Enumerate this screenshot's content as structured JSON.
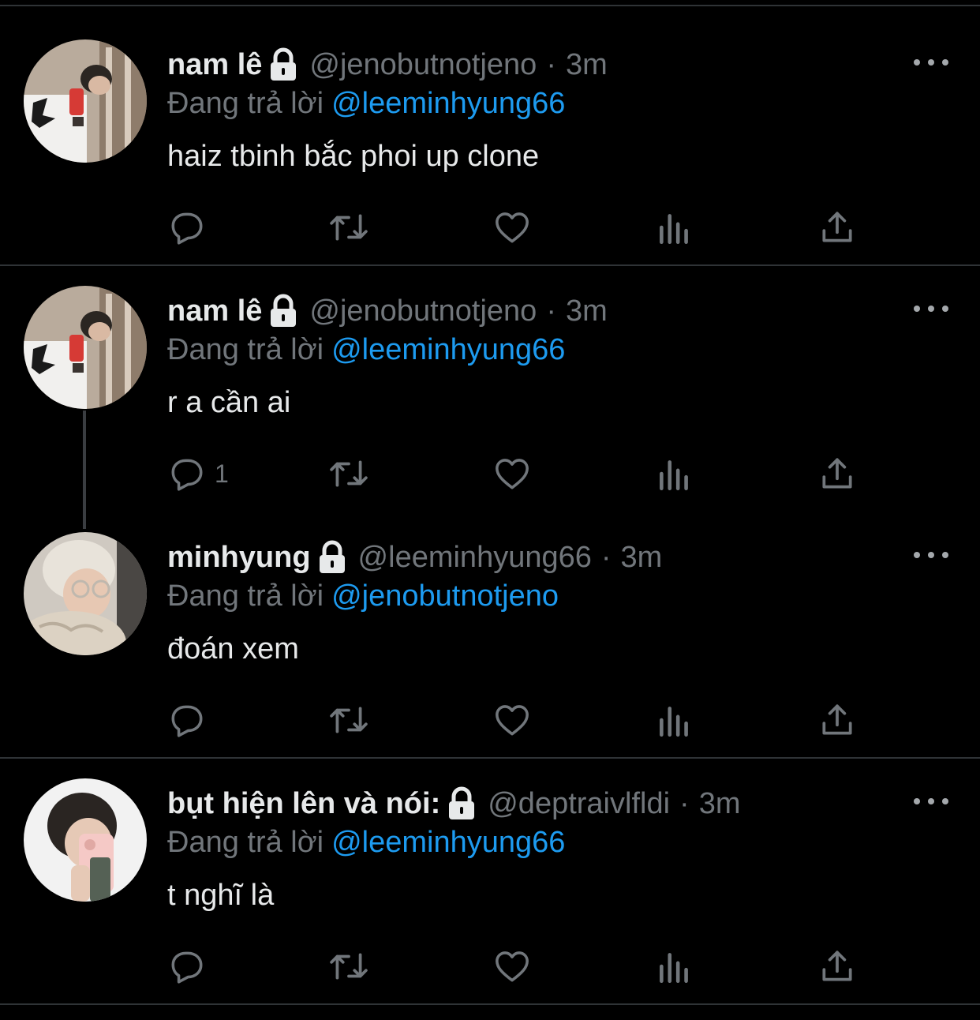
{
  "tweets": [
    {
      "name": "nam lê",
      "handle": "@jenobutnotjeno",
      "time": "3m",
      "replying_label": "Đang trả lời",
      "replying_to": "@leeminhyung66",
      "text": "haiz tbinh bắc phoi up clone",
      "reply_count": "",
      "avatar": "avatar-mirror-selfie-phone"
    },
    {
      "name": "nam lê",
      "handle": "@jenobutnotjeno",
      "time": "3m",
      "replying_label": "Đang trả lời",
      "replying_to": "@leeminhyung66",
      "text": "r a cần ai",
      "reply_count": "1",
      "avatar": "avatar-mirror-selfie-phone"
    },
    {
      "name": "minhyung",
      "handle": "@leeminhyung66",
      "time": "3m",
      "replying_label": "Đang trả lời",
      "replying_to": "@jenobutnotjeno",
      "text": "đoán xem",
      "reply_count": "",
      "avatar": "avatar-blond-glasses"
    },
    {
      "name": "bụt hiện lên và nói:",
      "handle": "@deptraivlfldi",
      "time": "3m",
      "replying_label": "Đang trả lời",
      "replying_to": "@leeminhyung66",
      "text": "t nghĩ là",
      "reply_count": "",
      "avatar": "avatar-pink-phone-selfie"
    }
  ],
  "colors": {
    "background": "#000000",
    "text": "#e7e9ea",
    "secondary": "#71767b",
    "link": "#1d9bf0",
    "divider": "#2f3336"
  },
  "icons": [
    "reply-icon",
    "retweet-icon",
    "like-icon",
    "analytics-icon",
    "share-icon",
    "lock-icon",
    "more-icon"
  ]
}
